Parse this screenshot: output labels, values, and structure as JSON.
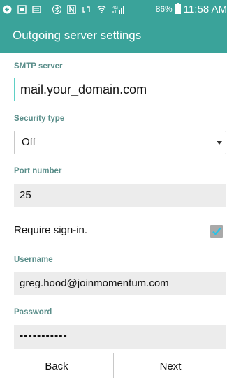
{
  "status_bar": {
    "battery": "86%",
    "time": "11:58 AM",
    "icons": [
      "back-arrow-icon",
      "gallery-icon",
      "message-icon",
      "bluetooth-icon",
      "nfc-icon",
      "cast-icon",
      "wifi-icon",
      "signal-4g-icon",
      "battery-icon"
    ]
  },
  "header": {
    "title": "Outgoing server settings"
  },
  "form": {
    "smtp_label": "SMTP server",
    "smtp_value": "mail.your_domain.com",
    "security_label": "Security type",
    "security_value": "Off",
    "port_label": "Port number",
    "port_value": "25",
    "require_signin_label": "Require sign-in.",
    "require_signin_checked": true,
    "username_label": "Username",
    "username_value": "greg.hood@joinmomentum.com",
    "password_label": "Password",
    "password_value": "•••••••••••"
  },
  "footer": {
    "back_label": "Back",
    "next_label": "Next"
  },
  "colors": {
    "accent": "#3aa39a",
    "field_bg": "#ececec",
    "label": "#5a8e8a",
    "focus_border": "#5fd0c5"
  }
}
